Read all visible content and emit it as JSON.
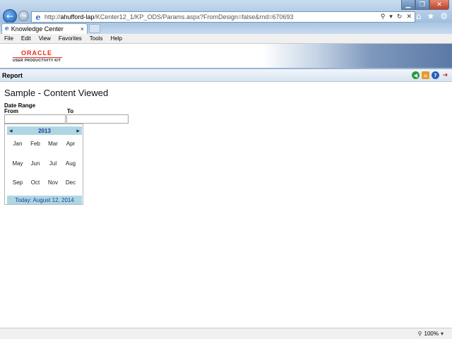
{
  "browser": {
    "address": {
      "prefix": "http://",
      "host": "ahufford-lap",
      "path": "/KCenter12_1/KP_ODS/Params.aspx?FromDesign=false&rnd=670693"
    },
    "tab": {
      "label": "Knowledge Center",
      "close": "×"
    },
    "menu": [
      "File",
      "Edit",
      "View",
      "Favorites",
      "Tools",
      "Help"
    ],
    "zoom": "100%",
    "icons": {
      "back": "back-arrow-icon",
      "forward": "forward-arrow-icon",
      "search": "search-icon",
      "refresh": "refresh-icon",
      "stop": "stop-icon",
      "home": "home-icon",
      "favorites": "star-icon",
      "tools": "gear-icon"
    }
  },
  "banner": {
    "logo_word": "ORACLE",
    "logo_sub": "USER PRODUCTIVITY KIT"
  },
  "report_bar": {
    "title": "Report",
    "icons": [
      "back-icon",
      "home-icon",
      "help-icon",
      "exit-icon"
    ]
  },
  "page": {
    "title": "Sample - Content Viewed",
    "date_range_label": "Date Range",
    "from_label": "From",
    "to_label": "To",
    "from_value": "",
    "to_value": ""
  },
  "calendar": {
    "year": "2013",
    "months": [
      "Jan",
      "Feb",
      "Mar",
      "Apr",
      "May",
      "Jun",
      "Jul",
      "Aug",
      "Sep",
      "Oct",
      "Nov",
      "Dec"
    ],
    "today_text": "Today: August 12, 2014"
  },
  "colors": {
    "calendar_header": "#aed7e3",
    "calendar_text": "#1e3f9a",
    "oracle_red": "#e52d1d"
  }
}
